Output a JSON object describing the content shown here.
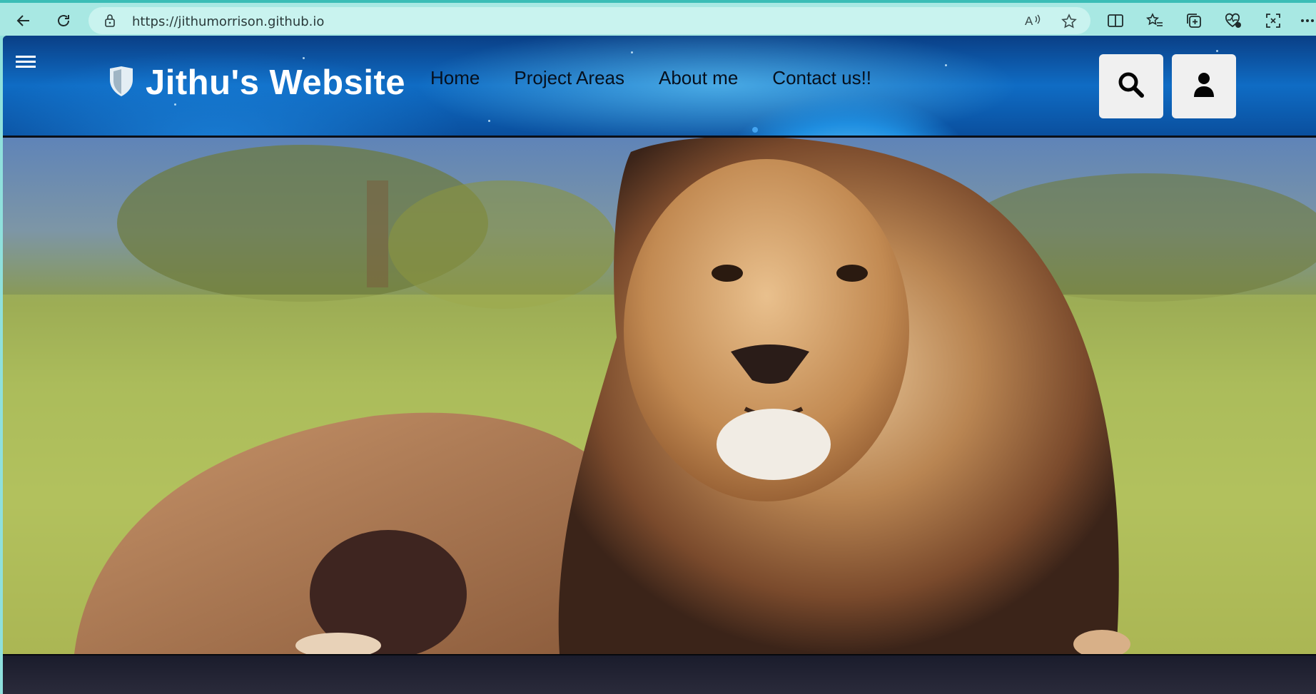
{
  "browser": {
    "url": "https://jithumorrison.github.io",
    "icons": [
      "back-icon",
      "refresh-icon",
      "lock-icon",
      "read-aloud-icon",
      "favorite-star-icon",
      "split-screen-icon",
      "favorites-icon",
      "collections-icon",
      "health-icon",
      "screenshot-icon",
      "more-icon"
    ]
  },
  "site": {
    "title": "Jithu's Website",
    "logo_icon": "shield-icon",
    "nav": [
      {
        "label": "Home"
      },
      {
        "label": "Project Areas"
      },
      {
        "label": "About me"
      },
      {
        "label": "Contact us!!"
      }
    ],
    "header_buttons": [
      "search-icon",
      "user-icon"
    ],
    "menu_icon": "hamburger-icon"
  },
  "hero": {
    "image": "lion resting on grassland"
  },
  "colors": {
    "chrome": "#a8e8e3",
    "header_blue": "#0f6cc4",
    "button_bg": "#f0f0f0"
  }
}
